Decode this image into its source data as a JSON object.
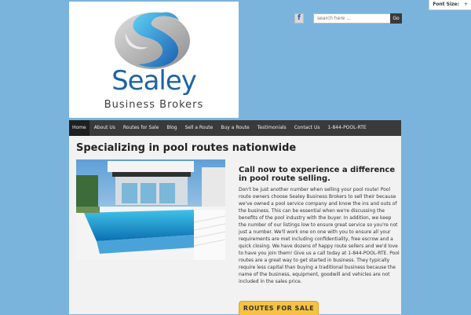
{
  "font_size_widget": {
    "label": "Font Size:",
    "plus": "+"
  },
  "logo": {
    "title": "Sealey",
    "subtitle": "Business Brokers",
    "alt": "Sealey Business Brokers logo"
  },
  "header": {
    "facebook_icon": "f",
    "search_placeholder": "search here ...",
    "search_button": "Go"
  },
  "nav": {
    "items": [
      {
        "label": "Home",
        "active": true
      },
      {
        "label": "About Us"
      },
      {
        "label": "Routes for Sale"
      },
      {
        "label": "Blog"
      },
      {
        "label": "Sell a Route"
      },
      {
        "label": "Buy a Route"
      },
      {
        "label": "Testimonials"
      },
      {
        "label": "Contact Us"
      },
      {
        "label": "1-844-POOL-RTE"
      }
    ]
  },
  "content": {
    "title": "Specializing in pool routes nationwide",
    "call_heading": "Call now to experience a difference in pool route selling.",
    "body": "Don't be just another number when selling your pool route! Pool route owners choose Sealey Business Brokers to sell their because we've owned a pool service company and know the ins and outs of the business. This can be essential when we're discussing the benefits of the pool industry with the buyer. In addition, we keep the number of our listings low to ensure great service so you're not just a number. We'll work one on one with you to ensure all your requirements are met including confidentiality, free escrow and a quick closing. We have dozens of happy route sellers and we'd love to have you join them! Give us a call today at 1-844-POOL-RTE. Pool routes are a great way to get started in business. They typically require less capital than buying a traditional business because the name of the business, equipment, goodwill and vehicles are not included in the sales price.",
    "routes_button": "ROUTES FOR SALE"
  },
  "colors": {
    "page_bg": "#7ab4dc",
    "nav_bg": "#3a3a3a",
    "brand_blue": "#1d63a6",
    "button": "#f5c242"
  }
}
